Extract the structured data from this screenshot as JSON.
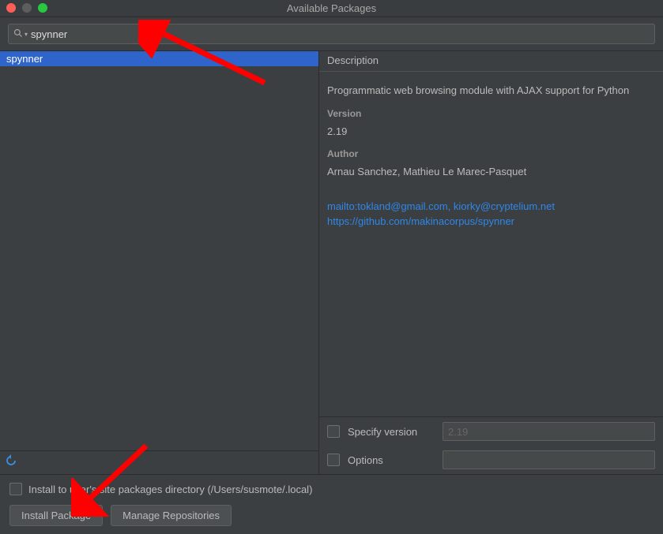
{
  "window": {
    "title": "Available Packages"
  },
  "search": {
    "value": "spynner"
  },
  "results": {
    "items": [
      {
        "name": "spynner",
        "selected": true
      }
    ]
  },
  "description": {
    "header": "Description",
    "summary": "Programmatic web browsing module with AJAX support for Python",
    "version_label": "Version",
    "version": "2.19",
    "author_label": "Author",
    "author": "Arnau Sanchez, Mathieu Le Marec-Pasquet",
    "mailto": "mailto:tokland@gmail.com, kiorky@cryptelium.net",
    "homepage": "https://github.com/makinacorpus/spynner"
  },
  "options": {
    "specify_version_label": "Specify version",
    "specify_version_value": "2.19",
    "options_label": "Options",
    "options_value": ""
  },
  "footer": {
    "install_user_label": "Install to user's site packages directory (/Users/susmote/.local)",
    "install_button": "Install Package",
    "manage_button": "Manage Repositories"
  }
}
